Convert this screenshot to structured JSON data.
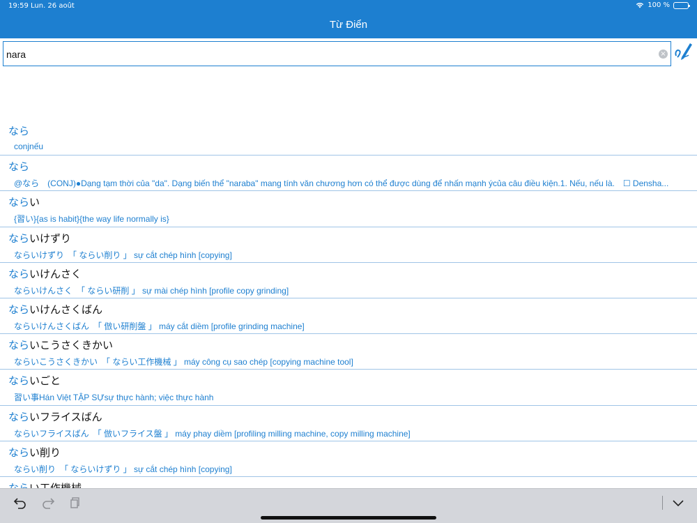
{
  "status_bar": {
    "time": "19:59",
    "date": "Lun. 26 août",
    "battery": "100 %"
  },
  "header": {
    "title": "Từ Điển"
  },
  "search": {
    "value": "nara",
    "placeholder": ""
  },
  "results": [
    {
      "match": "なら",
      "rest": "",
      "meaning": "conjnếu"
    },
    {
      "match": "なら",
      "rest": "",
      "meaning": "@なら　(CONJ)●Dạng tạm thời của \"da\". Dạng biến thể \"naraba\" mang tính văn chương hơn có thể được dùng để nhấn mạnh ýcủa câu điều kiện.1. Nếu, nếu là.　☐ Densha..."
    },
    {
      "match": "なら",
      "rest": "い",
      "meaning": "{習い}{as is habit}{the way life normally is}"
    },
    {
      "match": "なら",
      "rest": "いけずり",
      "meaning": "ならいけずり　「 ならい削り 」 sự cắt chép hình [copying]"
    },
    {
      "match": "なら",
      "rest": "いけんさく",
      "meaning": "ならいけんさく　「 ならい研削 」 sự mài chép hình [profile copy grinding]"
    },
    {
      "match": "なら",
      "rest": "いけんさくばん",
      "meaning": "ならいけんさくばん　「 倣い研削盤 」 máy cắt diềm [profile grinding machine]"
    },
    {
      "match": "なら",
      "rest": "いこうさくきかい",
      "meaning": "ならいこうさくきかい　「 ならい工作機械 」 máy công cụ sao chép [copying machine tool]"
    },
    {
      "match": "なら",
      "rest": "いごと",
      "meaning": "習い事Hán Việt  TẬP SỰsự thực hành; việc thực hành"
    },
    {
      "match": "なら",
      "rest": "いフライスばん",
      "meaning": "ならいフライスばん　「 倣いフライス盤 」 máy phay diềm [profiling milling machine, copy milling machine]"
    },
    {
      "match": "なら",
      "rest": "い削り",
      "meaning": "ならい削り　「 ならいけずり 」 sự cắt chép hình [copying]"
    },
    {
      "match": "なら",
      "rest": "い工作機械",
      "meaning": ""
    }
  ],
  "colors": {
    "accent": "#1d7fd0",
    "toolbar": "#d4d6db"
  }
}
